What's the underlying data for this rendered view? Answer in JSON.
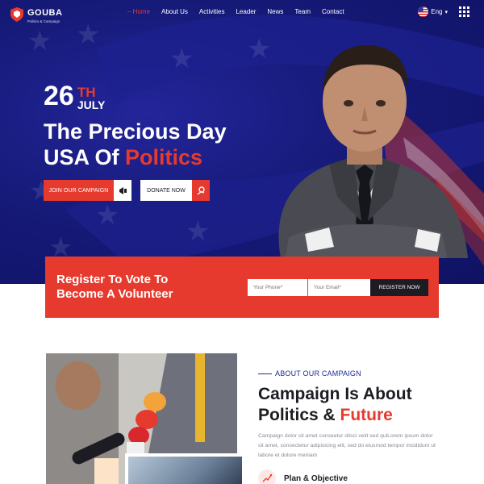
{
  "brand": {
    "name": "GOUBA",
    "tagline": "Politics & Campaign"
  },
  "nav": {
    "items": [
      {
        "label": "– Home",
        "active": true
      },
      {
        "label": "About Us"
      },
      {
        "label": "Activities"
      },
      {
        "label": "Leader"
      },
      {
        "label": "News"
      },
      {
        "label": "Team"
      },
      {
        "label": "Contact"
      }
    ],
    "language": "Eng"
  },
  "hero": {
    "day": "26",
    "day_suffix": "TH",
    "month": "JULY",
    "title_line1": "The Precious Day",
    "title_line2_prefix": "USA Of ",
    "title_line2_accent": "Politics",
    "join_label": "JOIN OUR CAMPAIGN",
    "donate_label": "DONATE NOW"
  },
  "register": {
    "title_line1": "Register To Vote To",
    "title_line2": "Become A Volunteer",
    "phone_placeholder": "Your Phone*",
    "email_placeholder": "Your Email*",
    "button_label": "REGISTER NOW"
  },
  "about": {
    "eyebrow": "ABOUT OUR CAMPAIGN",
    "heading_line1": "Campaign Is About",
    "heading_line2_prefix": "Politics & ",
    "heading_line2_accent": "Future",
    "body": "Campaign dolor sit amet conseetur diisci velit sed quiLorem ipsum dolor sit amet, consectetur adipisicing elit, sed do eiusmod tempor incididunt ut labore et dolore meniam",
    "feature_title": "Plan & Objective"
  },
  "colors": {
    "primary": "#e63a2e",
    "navy": "#161a78",
    "dark": "#1c1c22"
  }
}
